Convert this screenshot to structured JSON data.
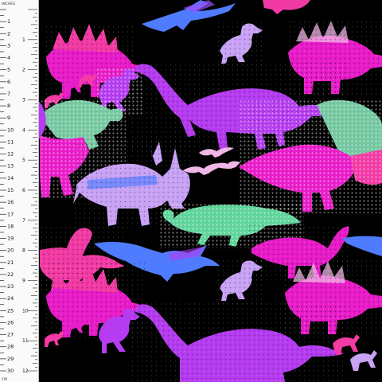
{
  "image": {
    "background": "#000000",
    "palette": {
      "magenta": "#e81cc8",
      "hot_pink": "#f23aa4",
      "violet": "#b53cf0",
      "purple": "#8f35e6",
      "lavender": "#c8a2f5",
      "light_pink": "#f0b7e6",
      "sea_green": "#5fd49a",
      "sky_blue": "#4f7cff",
      "teal_green": "#74c7a0"
    }
  },
  "ruler": {
    "units_top": "INCHES",
    "units_bottom": "CM",
    "cm_labels": [
      "1",
      "2",
      "3",
      "4",
      "5",
      "6",
      "7",
      "8",
      "9",
      "10",
      "11",
      "12",
      "13",
      "14",
      "15",
      "16",
      "17",
      "18",
      "19",
      "20",
      "21",
      "22",
      "23",
      "24",
      "25",
      "26",
      "27",
      "28",
      "29",
      "30"
    ],
    "inch_labels": [
      "1",
      "2",
      "3",
      "4",
      "5",
      "6",
      "7",
      "8",
      "9",
      "10",
      "11",
      "12"
    ]
  },
  "dinosaurs": [
    {
      "kind": "stegosaurus",
      "color": "magenta"
    },
    {
      "kind": "pterodactyl",
      "color": "sky_blue"
    },
    {
      "kind": "t-rex-small",
      "color": "lavender"
    },
    {
      "kind": "brachiosaurus",
      "color": "violet"
    },
    {
      "kind": "t-rex",
      "color": "teal_green"
    },
    {
      "kind": "triceratops",
      "color": "lavender"
    },
    {
      "kind": "plesiosaur",
      "color": "sea_green"
    },
    {
      "kind": "sauropod",
      "color": "hot_pink"
    },
    {
      "kind": "pterodactyl",
      "color": "light_pink"
    }
  ]
}
